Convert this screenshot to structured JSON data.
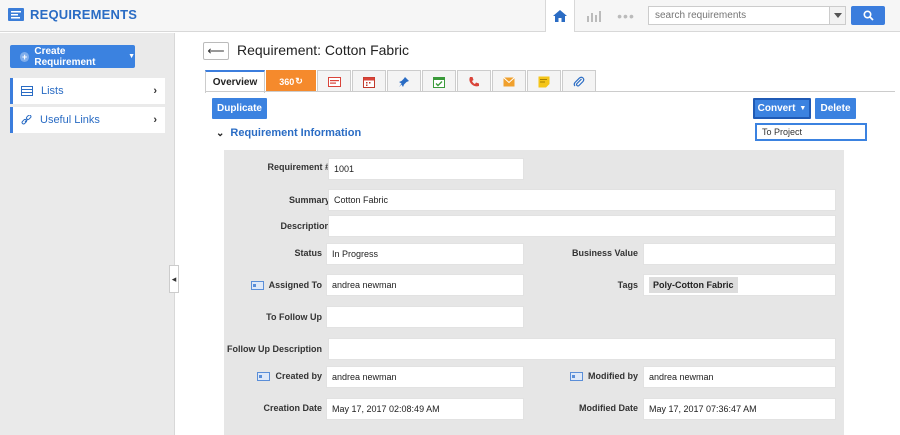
{
  "app": {
    "title": "REQUIREMENTS"
  },
  "search": {
    "placeholder": "search requirements"
  },
  "sidebar": {
    "create_label": "Create Requirement",
    "items": [
      {
        "label": "Lists",
        "icon": "list-icon"
      },
      {
        "label": "Useful Links",
        "icon": "link-icon"
      }
    ]
  },
  "page": {
    "title": "Requirement: Cotton Fabric"
  },
  "tabs": {
    "overview": "Overview",
    "t360": "360",
    "icons": [
      "card-icon",
      "calendar-icon",
      "pin-icon",
      "task-check-icon",
      "phone-icon",
      "mail-icon",
      "note-icon",
      "paperclip-icon"
    ]
  },
  "actions": {
    "duplicate": "Duplicate",
    "convert": "Convert",
    "delete": "Delete",
    "convert_menu_item": "To Project"
  },
  "section": {
    "title": "Requirement Information"
  },
  "form": {
    "requirement_no": {
      "label": "Requirement #",
      "value": "1001"
    },
    "summary": {
      "label": "Summary",
      "value": "Cotton Fabric"
    },
    "description": {
      "label": "Description",
      "value": ""
    },
    "status": {
      "label": "Status",
      "value": "In Progress"
    },
    "business_value": {
      "label": "Business Value",
      "value": ""
    },
    "assigned_to": {
      "label": "Assigned To",
      "value": "andrea newman"
    },
    "tags": {
      "label": "Tags",
      "value": "Poly-Cotton Fabric"
    },
    "to_follow_up": {
      "label": "To Follow Up",
      "value": ""
    },
    "follow_up_description": {
      "label": "Follow Up Description",
      "value": ""
    },
    "created_by": {
      "label": "Created by",
      "value": "andrea newman"
    },
    "modified_by": {
      "label": "Modified by",
      "value": "andrea newman"
    },
    "creation_date": {
      "label": "Creation Date",
      "value": "May 17, 2017 02:08:49 AM"
    },
    "modified_date": {
      "label": "Modified Date",
      "value": "May 17, 2017 07:36:47 AM"
    }
  },
  "colors": {
    "accent": "#3b82e0",
    "brand": "#2a6cc4",
    "tab_360": "#f58a2c"
  }
}
